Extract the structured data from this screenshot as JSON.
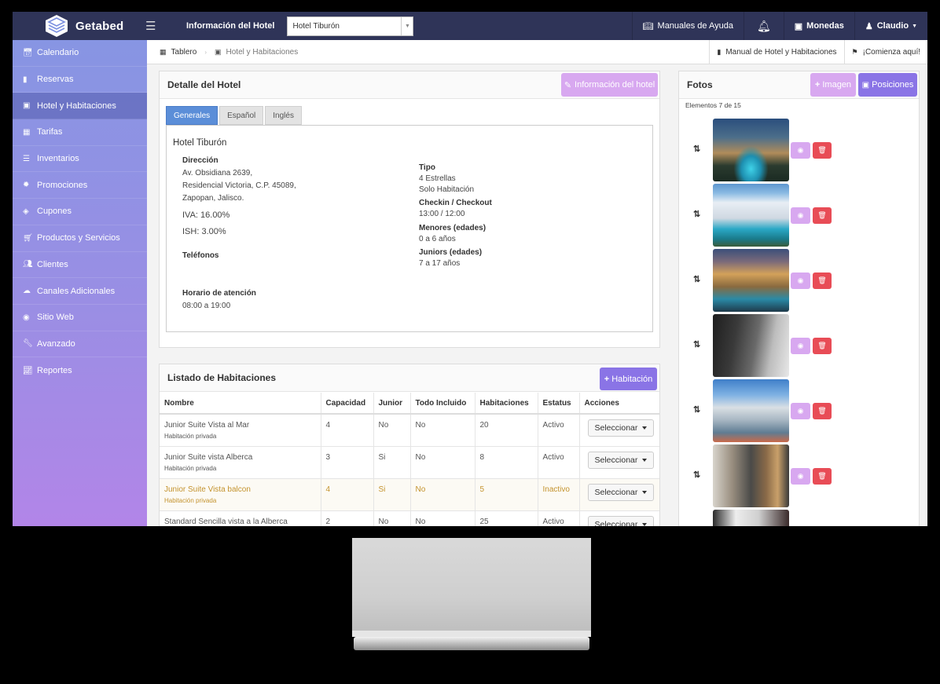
{
  "topbar": {
    "brand": "Getabed",
    "hotel_info_label": "Información del Hotel",
    "hotel_select_value": "Hotel Tiburón",
    "manuals": "Manuales de Ayuda",
    "currency": "Monedas",
    "user": "Claudio"
  },
  "sidebar": {
    "items": [
      {
        "label": "Calendario",
        "icon": "calendar-icon"
      },
      {
        "label": "Reservas",
        "icon": "book-icon"
      },
      {
        "label": "Hotel y Habitaciones",
        "icon": "hotel-icon"
      },
      {
        "label": "Tarifas",
        "icon": "table-icon"
      },
      {
        "label": "Inventarios",
        "icon": "list-icon"
      },
      {
        "label": "Promociones",
        "icon": "cog-icon"
      },
      {
        "label": "Cupones",
        "icon": "tags-icon"
      },
      {
        "label": "Productos y Servicios",
        "icon": "cart-icon"
      },
      {
        "label": "Clientes",
        "icon": "users-icon"
      },
      {
        "label": "Canales Adicionales",
        "icon": "cloud-icon"
      },
      {
        "label": "Sitio Web",
        "icon": "globe-icon"
      },
      {
        "label": "Avanzado",
        "icon": "wrench-icon"
      },
      {
        "label": "Reportes",
        "icon": "chart-icon"
      }
    ]
  },
  "breadcrumb": {
    "home": "Tablero",
    "current": "Hotel y Habitaciones",
    "manual_link": "Manual de Hotel y Habitaciones",
    "start_link": "¡Comienza aquí!"
  },
  "detail": {
    "title": "Detalle del Hotel",
    "info_button": "Información del hotel",
    "tabs": [
      "Generales",
      "Español",
      "Inglés"
    ],
    "hotel_name": "Hotel Tiburón",
    "address_label": "Dirección",
    "address_lines": [
      "Av. Obsidiana 2639,",
      "Residencial Victoria, C.P. 45089,",
      "Zapopan, Jalisco."
    ],
    "iva": "IVA: 16.00%",
    "ish": "ISH: 3.00%",
    "phones_label": "Teléfonos",
    "hours_label": "Horario de atención",
    "hours_value": "08:00 a 19:00",
    "type_label": "Tipo",
    "type_lines": [
      "4 Estrellas",
      "Solo Habitación"
    ],
    "checkin_label": "Checkin / Checkout",
    "checkin_value": "13:00 / 12:00",
    "minors_label": "Menores (edades)",
    "minors_value": "0 a 6 años",
    "juniors_label": "Juniors (edades)",
    "juniors_value": "7 a 17 años"
  },
  "rooms": {
    "title": "Listado de Habitaciones",
    "add_button": "Habitación",
    "columns": [
      "Nombre",
      "Capacidad",
      "Junior",
      "Todo Incluido",
      "Habitaciones",
      "Estatus",
      "Acciones"
    ],
    "rows": [
      {
        "name": "Junior Suite Vista al Mar",
        "sub": "Habitación privada",
        "capacity": "4",
        "junior": "No",
        "all_inclusive": "No",
        "rooms": "20",
        "status": "Activo",
        "action": "Seleccionar"
      },
      {
        "name": "Junior Suite vista Alberca",
        "sub": "Habitación privada",
        "capacity": "3",
        "junior": "Si",
        "all_inclusive": "No",
        "rooms": "8",
        "status": "Activo",
        "action": "Seleccionar"
      },
      {
        "name": "Junior Suite Vista balcon",
        "sub": "Habitación privada",
        "capacity": "4",
        "junior": "Si",
        "all_inclusive": "No",
        "rooms": "5",
        "status": "Inactivo",
        "action": "Seleccionar"
      },
      {
        "name": "Standard Sencilla vista a la Alberca",
        "sub": "",
        "capacity": "2",
        "junior": "No",
        "all_inclusive": "No",
        "rooms": "25",
        "status": "Activo",
        "action": "Seleccionar"
      }
    ]
  },
  "photos": {
    "title": "Fotos",
    "image_button": "Imagen",
    "positions_button": "Posiciones",
    "count_text": "Elementos 7 de 15"
  },
  "colors": {
    "topbar": "#2f3458",
    "sidebar_top": "#8795e3",
    "sidebar_bottom": "#b285e8",
    "lavender_button": "#d8a8f0",
    "purple_button": "#8a74e6",
    "danger": "#e84c56",
    "active_tab": "#5b8ed8",
    "inactive_row_text": "#c4932e"
  }
}
